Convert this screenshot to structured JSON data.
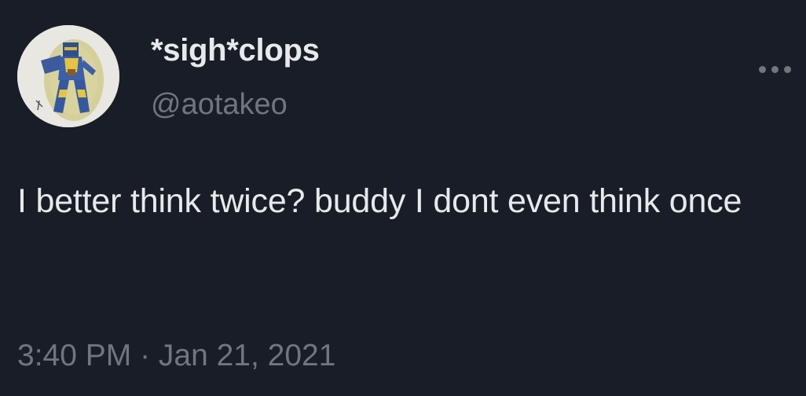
{
  "author": {
    "display_name": "*sigh*clops",
    "handle": "@aotakeo",
    "avatar_icon": "avatar-image"
  },
  "tweet": {
    "text": "I better think twice? buddy I dont even think once",
    "timestamp": "3:40 PM · Jan 21, 2021"
  },
  "actions": {
    "more_icon": "more-horizontal-icon"
  },
  "colors": {
    "background": "#181d27",
    "primary_text": "#e7e9ea",
    "secondary_text": "#71767b"
  }
}
